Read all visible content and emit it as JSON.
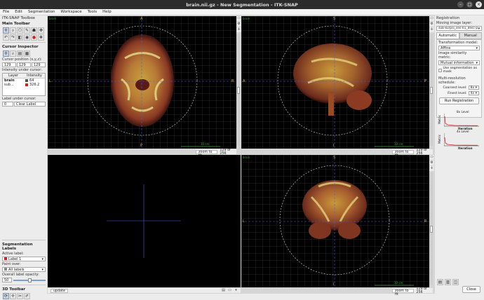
{
  "window": {
    "title": "brain.nii.gz - New Segmentation - ITK-SNAP"
  },
  "menu": [
    "File",
    "Edit",
    "Segmentation",
    "Workspace",
    "Tools",
    "Help"
  ],
  "toolbox": {
    "title": "ITK-SNAP Toolbox",
    "main_toolbar": "Main Toolbar",
    "cursor_inspector": "Cursor Inspector",
    "cursor_position_label": "Cursor position (x,y,z):",
    "cursor_x": "129",
    "cursor_y": "129",
    "cursor_z": "129",
    "intensity_label": "Intensity under cursor:",
    "col_layer": "Layer",
    "col_intensity": "Intensity",
    "rows": [
      {
        "layer": "brain",
        "value": "64",
        "color": "#555555"
      },
      {
        "layer": "sub...",
        "value": "326.2",
        "color": "#d61e1e"
      }
    ],
    "label_under_cursor": "Label under cursor:",
    "label_value": "0",
    "label_name": "Clear Label",
    "seg_labels": "Segmentation Labels",
    "active_label": "Active label:",
    "active_label_value": "Label 1",
    "active_color": "#d61e1e",
    "paint_over": "Paint over:",
    "paint_over_value": "All labels",
    "opacity_label": "Overall label opacity:",
    "opacity_value": "50",
    "toolbar3d": "3D Toolbar"
  },
  "views": {
    "layer_name": "brain",
    "zoom_fit": "zoom to fit",
    "slice_axial": "129 of 256",
    "slice_sagittal": "129 of 256",
    "slice_coronal": "129 of 256",
    "scale_label": "10 cm",
    "update": "update",
    "dirs": {
      "A": "A",
      "P": "P",
      "L": "L",
      "R": "R",
      "S": "S",
      "I": "I"
    }
  },
  "registration": {
    "title": "Registration",
    "moving_label": "Moving image layer:",
    "moving_value": "sub-kurpsi_ses-01_desc-p",
    "tab_auto": "Automatic",
    "tab_manual": "Manual",
    "transform_label": "Transformation model:",
    "transform_value": "Affine",
    "metric_label": "Image similarity metric:",
    "metric_value": "Mutual information",
    "use_seg": "Use segmentation as mask",
    "multires": "Multi-resolution schedule:",
    "coarsest_label": "Coarsest level:",
    "coarsest_value": "8x",
    "finest_label": "Finest level:",
    "finest_value": "4x",
    "run": "Run Registration",
    "plot1_title": "8x Level",
    "plot2_title": "4x Level",
    "plot_x": "Iteration",
    "plot_y": "Metric",
    "close": "Close"
  }
}
